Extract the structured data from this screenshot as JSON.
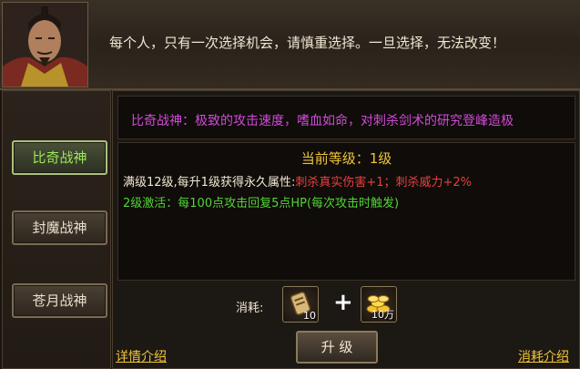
{
  "dialog": {
    "text": "每个人，只有一次选择机会，请慎重选择。一旦选择，无法改变！"
  },
  "sidebar": {
    "items": [
      {
        "label": "比奇战神",
        "active": true
      },
      {
        "label": "封魔战神",
        "active": false
      },
      {
        "label": "苍月战神",
        "active": false
      }
    ]
  },
  "description": "比奇战神：极致的攻击速度，嗜血如命，对刺杀剑术的研究登峰造极",
  "info": {
    "level_label": "当前等级：",
    "level_value": "1级",
    "attr_prefix": "满级12级,每升1级获得永久属性:",
    "attr_bonus": "刺杀真实伤害+1；刺杀威力+2%",
    "activate": "2级激活：每100点攻击回复5点HP(每次攻击时触发)"
  },
  "cost": {
    "label": "消耗:",
    "items": [
      {
        "icon": "scroll-item-icon",
        "count": "10"
      },
      {
        "icon": "gold-coins-icon",
        "count": "10万"
      }
    ],
    "plus": "+"
  },
  "buttons": {
    "upgrade": "升 级"
  },
  "links": {
    "details": "详情介绍",
    "cost_intro": "消耗介绍"
  },
  "colors": {
    "active_green": "#9bea55",
    "description_magenta": "#d24ad9",
    "level_gold": "#f0c43b",
    "bonus_red": "#e84040",
    "activate_green": "#52d437"
  }
}
